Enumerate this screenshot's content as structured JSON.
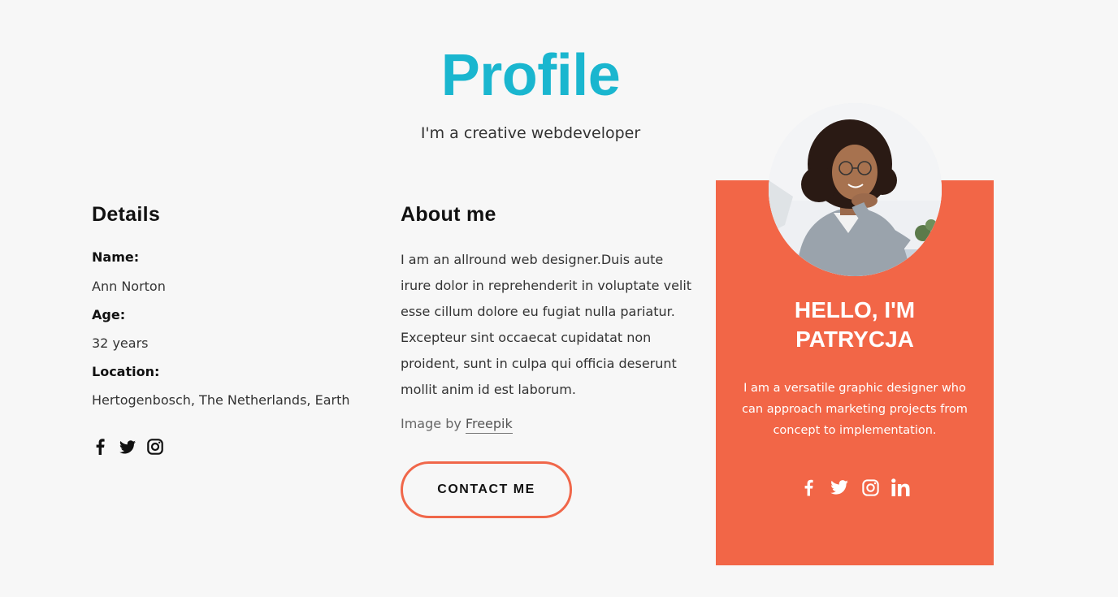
{
  "hero": {
    "title": "Profile",
    "subtitle": "I'm a creative webdeveloper"
  },
  "details": {
    "heading": "Details",
    "fields": [
      {
        "label": "Name:",
        "value": "Ann Norton"
      },
      {
        "label": "Age:",
        "value": "32 years"
      },
      {
        "label": "Location:",
        "value": "Hertogenbosch, The Netherlands, Earth"
      }
    ],
    "social_icons": [
      "facebook-icon",
      "twitter-icon",
      "instagram-icon"
    ]
  },
  "about": {
    "heading": "About me",
    "text": "I am an allround web designer.Duis aute irure dolor in reprehenderit in voluptate velit esse cillum dolore eu fugiat nulla pariatur. Excepteur sint occaecat cupidatat non proident, sunt in culpa qui officia deserunt mollit anim id est laborum.",
    "credit_prefix": "Image by",
    "credit_link": "Freepik",
    "contact_label": "CONTACT ME"
  },
  "card": {
    "title_line1": "HELLO, I'M",
    "title_line2": "PATRYCJA",
    "text": "I am a versatile graphic designer who can approach marketing projects from concept to implementation.",
    "social_icons": [
      "facebook-icon",
      "twitter-icon",
      "instagram-icon",
      "linkedin-icon"
    ]
  },
  "colors": {
    "accent_cyan": "#1ab6cf",
    "card_orange": "#f26647",
    "button_border": "#f0674a",
    "background": "#f7f7f7"
  }
}
